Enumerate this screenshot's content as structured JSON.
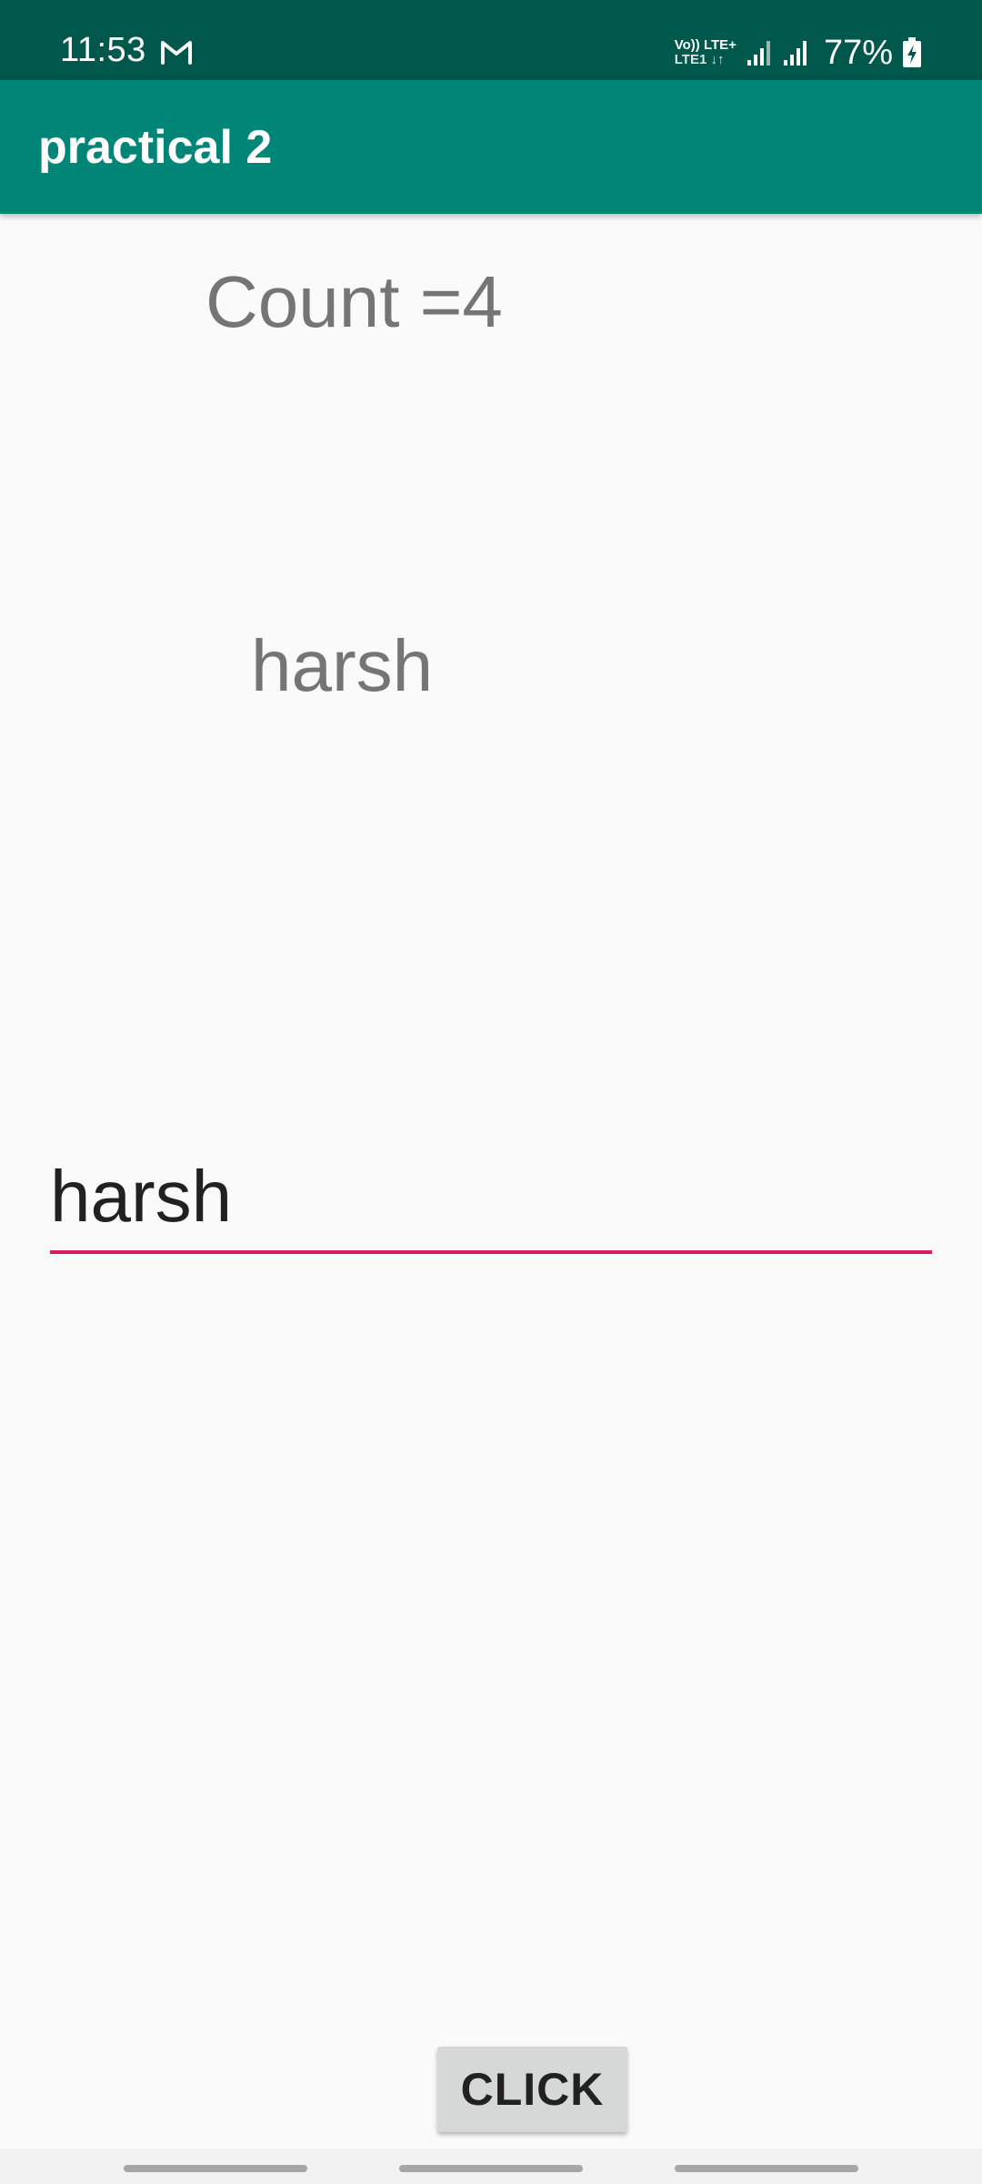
{
  "status_bar": {
    "time": "11:53",
    "network_top": "Vo)) LTE+",
    "network_bottom": "LTE1 ↓↑",
    "battery": "77%",
    "icons": [
      "gmail-icon",
      "signal-icon",
      "signal-icon",
      "battery-charging-icon"
    ]
  },
  "app_bar": {
    "title": "practical 2"
  },
  "content": {
    "count_text": "Count =4",
    "name_text": "harsh",
    "input_value": "harsh",
    "button_label": "CLICK"
  },
  "colors": {
    "status_bar": "#00574b",
    "app_bar": "#008577",
    "accent": "#d81b60",
    "background": "#fafafa"
  }
}
